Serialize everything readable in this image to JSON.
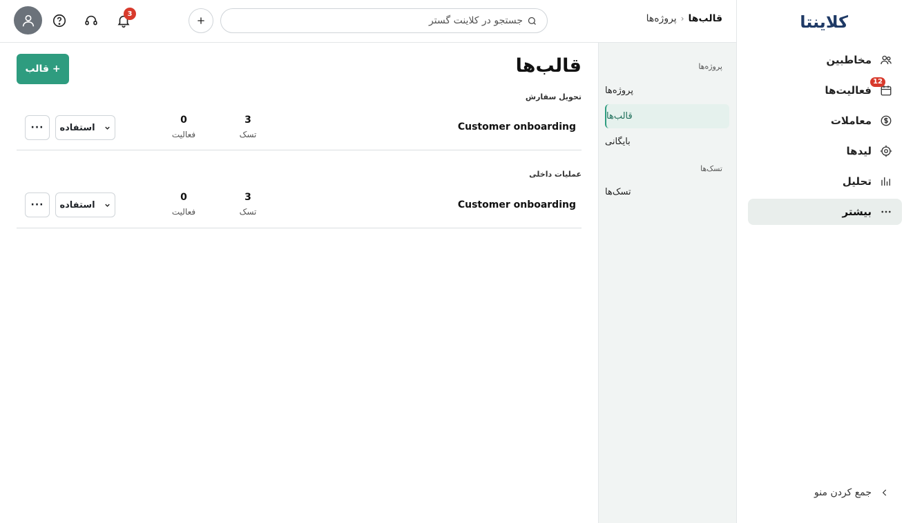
{
  "app": {
    "logo": "کلاینتا"
  },
  "sidebar": {
    "items": [
      {
        "label": "مخاطبین",
        "icon": "users-icon"
      },
      {
        "label": "فعالیت‌ها",
        "icon": "calendar-icon",
        "badge": "12"
      },
      {
        "label": "معاملات",
        "icon": "coin-icon"
      },
      {
        "label": "لیدها",
        "icon": "target-icon"
      },
      {
        "label": "تحلیل",
        "icon": "bar-chart-icon"
      },
      {
        "label": "بیشتر",
        "icon": "more-dots-icon",
        "active": true
      }
    ],
    "collapse_label": "جمع کردن منو"
  },
  "header": {
    "breadcrumb": {
      "parent": "پروژه‌ها",
      "current": "قالب‌ها"
    },
    "search_placeholder": "جستجو در کلاینت گستر",
    "notification_count": "3"
  },
  "subnav": {
    "section_projects": "پروژه‌ها",
    "items_projects": [
      "پروژه‌ها",
      "قالب‌ها",
      "بایگانی"
    ],
    "section_tasks": "تسک‌ها",
    "items_tasks": [
      "تسک‌ها"
    ],
    "active": "قالب‌ها"
  },
  "main": {
    "title": "قالب‌ها",
    "new_button": "+ قالب",
    "groups": [
      {
        "title": "تحویل سفارش",
        "rows": [
          {
            "name": "Customer onboarding",
            "tasks": "3",
            "tasks_label": "تسک",
            "activities": "0",
            "activities_label": "فعالیت",
            "use_label": "استفاده",
            "more": "···"
          }
        ]
      },
      {
        "title": "عملیات داخلی",
        "rows": [
          {
            "name": "Customer onboarding",
            "tasks": "3",
            "tasks_label": "تسک",
            "activities": "0",
            "activities_label": "فعالیت",
            "use_label": "استفاده",
            "more": "···"
          }
        ]
      }
    ]
  },
  "colors": {
    "accent": "#2e9c7f",
    "badge": "#d83a2c",
    "brand": "#1f3a66"
  }
}
